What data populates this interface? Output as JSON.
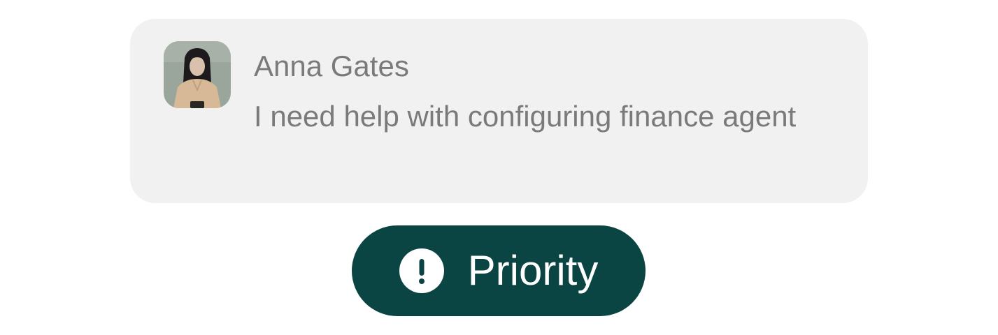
{
  "message": {
    "sender": "Anna Gates",
    "text": "I need help with configuring finance agent",
    "avatar_icon": "user-photo"
  },
  "priority": {
    "label": "Priority",
    "icon": "alert-circle-icon",
    "color": "#0b4543"
  },
  "colors": {
    "card_background": "#f1f1f1",
    "text": "#7a7a7a"
  }
}
